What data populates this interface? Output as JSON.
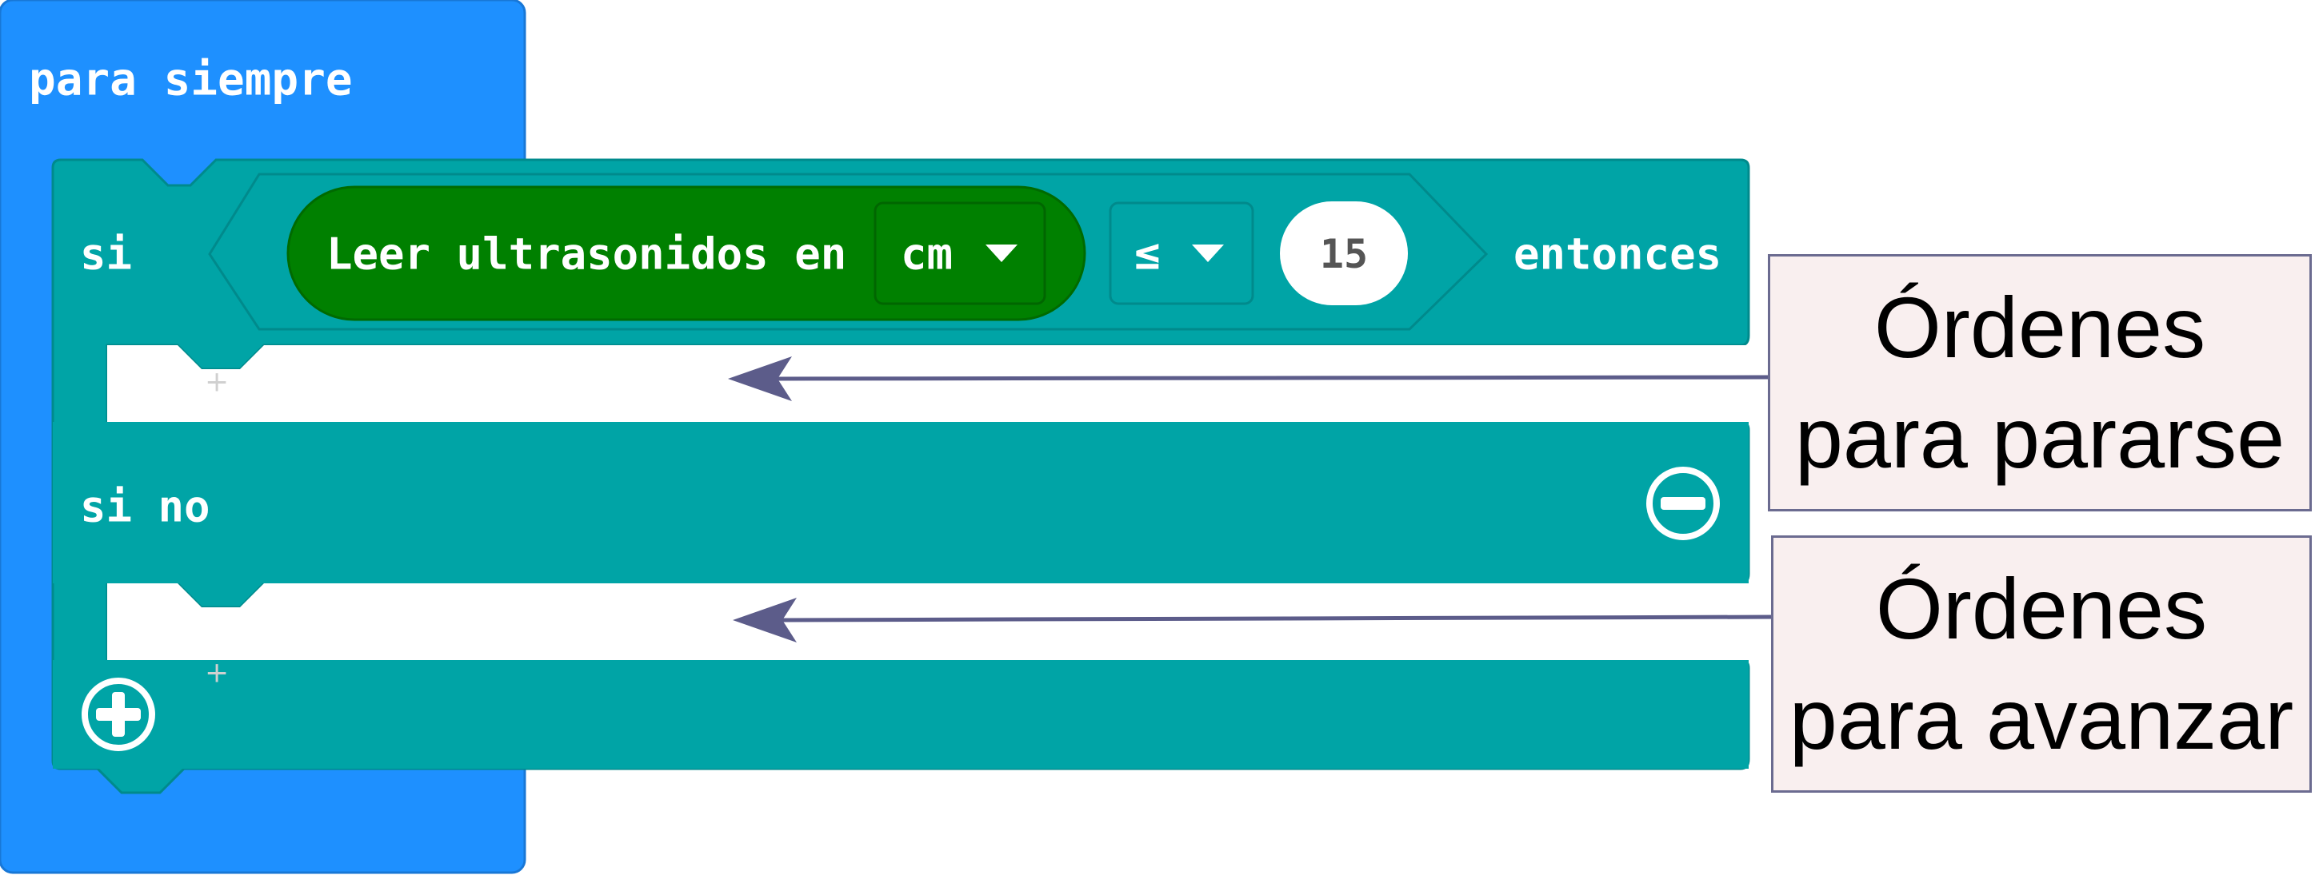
{
  "colors": {
    "loop_block": "#1e90ff",
    "if_block": "#00a4a6",
    "sensor_block": "#008000",
    "callout_fill": "#f9efef",
    "callout_border": "#6b6b90",
    "arrow": "#5c5c8a"
  },
  "loop": {
    "label": "para siempre"
  },
  "if_block": {
    "if_label": "si",
    "then_label": "entonces",
    "else_label": "si no",
    "remove_else_icon": "minus-circle-icon",
    "add_branch_icon": "plus-circle-icon"
  },
  "condition": {
    "sensor_label": "Leer ultrasonidos en",
    "unit_value": "cm",
    "operator_value": "≤",
    "compare_value": "15"
  },
  "callouts": {
    "stop": {
      "line1": "Órdenes",
      "line2": "para pararse"
    },
    "forward": {
      "line1": "Órdenes",
      "line2": "para avanzar"
    }
  }
}
